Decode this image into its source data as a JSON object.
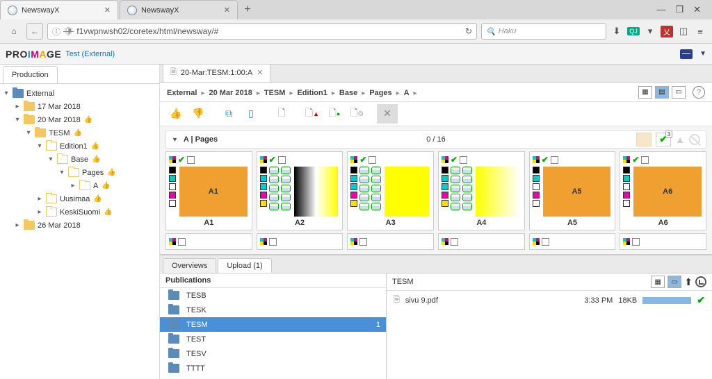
{
  "browser": {
    "tabs": [
      {
        "title": "NewswayX",
        "active": true
      },
      {
        "title": "NewswayX",
        "active": false
      }
    ],
    "url": "f1vwpnwsh02/coretex/html/newsway/#",
    "search_placeholder": "Haku",
    "win": {
      "min": "—",
      "max": "❐",
      "close": "✕"
    }
  },
  "app": {
    "logo_text": "PROIMAGE",
    "tenant": "Test (External)",
    "sidebar_tab": "Production",
    "doc_tab": "20-Mar:TESM:1:00:A"
  },
  "tree": {
    "root": "External",
    "items": [
      {
        "label": "17 Mar 2018",
        "depth": 1,
        "toggle": "▸",
        "fld": "fld-yel"
      },
      {
        "label": "20 Mar 2018",
        "depth": 1,
        "toggle": "▾",
        "fld": "fld-yel",
        "thumb": true
      },
      {
        "label": "TESM",
        "depth": 2,
        "toggle": "▾",
        "fld": "fld-yel",
        "thumb": true
      },
      {
        "label": "Edition1",
        "depth": 3,
        "toggle": "▾",
        "fld": "fld-outline",
        "thumb": true
      },
      {
        "label": "Base",
        "depth": 4,
        "toggle": "▾",
        "fld": "fld-outline",
        "thumb": true
      },
      {
        "label": "Pages",
        "depth": 5,
        "toggle": "▾",
        "fld": "fld-outline",
        "thumb": true
      },
      {
        "label": "A",
        "depth": 6,
        "toggle": "▸",
        "fld": "fld-outline",
        "thumb": true
      },
      {
        "label": "Uusimaa",
        "depth": 3,
        "toggle": "▸",
        "fld": "fld-outline",
        "thumb": true
      },
      {
        "label": "KeskiSuomi",
        "depth": 3,
        "toggle": "▸",
        "fld": "fld-outline",
        "thumb": true
      },
      {
        "label": "26 Mar 2018",
        "depth": 1,
        "toggle": "▸",
        "fld": "fld-yel"
      }
    ]
  },
  "breadcrumb": [
    "External",
    "20 Mar 2018",
    "TESM",
    "Edition1",
    "Base",
    "Pages",
    "A"
  ],
  "pages_header": {
    "title": "A | Pages",
    "count": "0 / 16",
    "badge": "3"
  },
  "pages": [
    {
      "label": "A1",
      "thumb": "thumb-orange",
      "seps": [
        "sw-k",
        "sw-c",
        "sw-w",
        "sw-m",
        "sw-w"
      ],
      "inks": 0,
      "showThumbLabel": true
    },
    {
      "label": "A2",
      "thumb": "thumb-grad",
      "seps": [
        "sw-k",
        "sw-c",
        "sw-c",
        "sw-m",
        "sw-y"
      ],
      "inks": 5
    },
    {
      "label": "A3",
      "thumb": "thumb-yel",
      "seps": [
        "sw-k",
        "sw-c",
        "sw-c",
        "sw-m",
        "sw-y"
      ],
      "inks": 5
    },
    {
      "label": "A4",
      "thumb": "thumb-fade",
      "seps": [
        "sw-k",
        "sw-c",
        "sw-c",
        "sw-m",
        "sw-y"
      ],
      "inks": 5
    },
    {
      "label": "A5",
      "thumb": "thumb-orange",
      "seps": [
        "sw-k",
        "sw-c",
        "sw-w",
        "sw-m",
        "sw-w"
      ],
      "inks": 0,
      "showThumbLabel": true
    },
    {
      "label": "A6",
      "thumb": "thumb-orange",
      "seps": [
        "sw-k",
        "sw-c",
        "sw-w",
        "sw-m",
        "sw-w"
      ],
      "inks": 0,
      "showThumbLabel": true
    }
  ],
  "bottom": {
    "tabs": {
      "overviews": "Overviews",
      "upload": "Upload (1)"
    },
    "left_title": "Publications",
    "publications": [
      {
        "name": "TESB"
      },
      {
        "name": "TESK"
      },
      {
        "name": "TESM",
        "selected": true,
        "count": "1"
      },
      {
        "name": "TEST"
      },
      {
        "name": "TESV"
      },
      {
        "name": "TTTT"
      }
    ],
    "right_title": "TESM",
    "file": {
      "name": "sivu 9.pdf",
      "time": "3:33 PM",
      "size": "18KB"
    }
  }
}
